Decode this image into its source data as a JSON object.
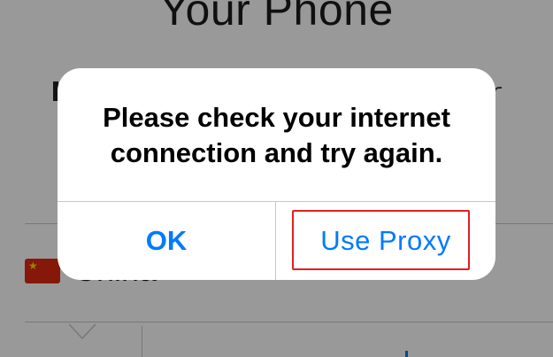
{
  "background_page": {
    "title": "Your Phone",
    "country": {
      "flag_icon": "china-flag-icon",
      "flag_star": "★",
      "name": "China"
    }
  },
  "alert": {
    "message": "Please check your internet connection and try again.",
    "buttons": {
      "ok_label": "OK",
      "proxy_label": "Use Proxy"
    }
  },
  "annotation": {
    "highlight_color": "#e02020",
    "highlight_target": "Use Proxy"
  },
  "colors": {
    "ios_blue": "#007aff",
    "overlay": "rgba(0,0,0,0.40)",
    "separator": "#c8c7cc"
  }
}
